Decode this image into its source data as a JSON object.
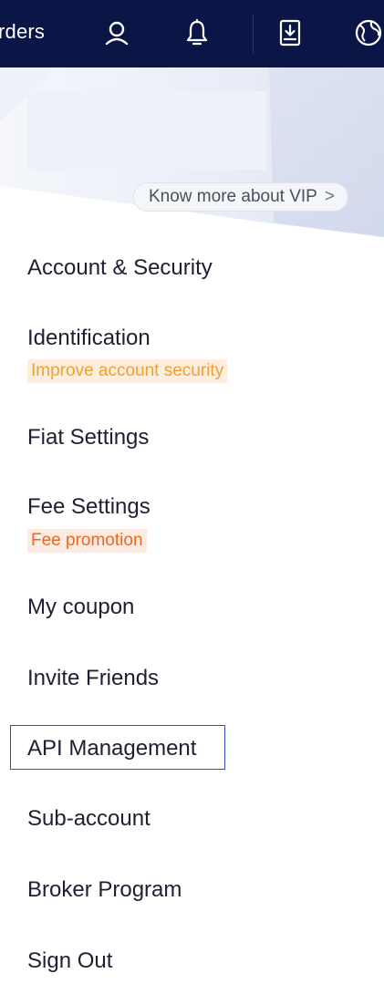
{
  "topbar": {
    "orders_label": "rders",
    "icons": [
      "user-icon",
      "bell-icon",
      "download-icon",
      "globe-icon"
    ]
  },
  "vip": {
    "link_label": "Know more about VIP",
    "chevron": ">"
  },
  "menu": {
    "account_security": "Account & Security",
    "identification": "Identification",
    "identification_tag": "Improve account security",
    "fiat_settings": "Fiat Settings",
    "fee_settings": "Fee Settings",
    "fee_tag": "Fee promotion",
    "my_coupon": "My coupon",
    "invite_friends": "Invite Friends",
    "api_management": "API Management",
    "sub_account": "Sub-account",
    "broker_program": "Broker Program",
    "sign_out": "Sign Out"
  },
  "colors": {
    "topbar_bg": "#0b1646",
    "tag_orange": "#f0a030",
    "tag_red": "#e66a25",
    "focus_border": "#2b55b5"
  }
}
